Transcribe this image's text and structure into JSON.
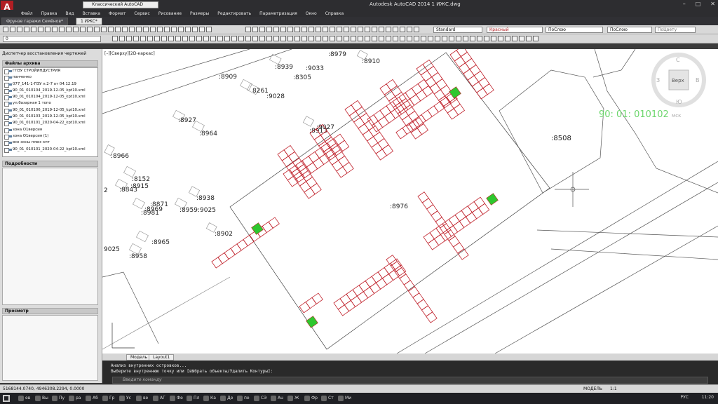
{
  "title": {
    "workspace": "Классический AutoCAD",
    "app": "Autodesk AutoCAD 2014    1 ИЖС.dwg"
  },
  "menu": [
    "Файл",
    "Правка",
    "Вид",
    "Вставка",
    "Формат",
    "Сервис",
    "Рисование",
    "Размеры",
    "Редактировать",
    "Параметризация",
    "Окно",
    "Справка"
  ],
  "tabs": {
    "first": "Фрунзе гаражи Семёнов*",
    "second": "1 ИЖС*"
  },
  "toolbar": {
    "layer_value": "0",
    "text_style": "Standard",
    "color": "Красный",
    "linetype": "ПоСлою",
    "lineweight": "ПоСлою",
    "plotstyle": "ПоЦвету"
  },
  "sidebar": {
    "title": "Диспетчер восстановления чертежей",
    "files_header": "Файлы архива",
    "files": [
      "ГПЗУ СТРОЙИНДУСТРИЯ",
      "панченко",
      "077_141-1-ПЗУ л.2-7 от 04.12.19",
      "90_01_010104_2019-12-05_kpt10.xml",
      "90_01_010104_2019-12-05_kpt10.xml",
      "ул.базарная 1 топо",
      "90_01_010106_2019-12-05_kpt10.xml",
      "90_01_010103_2019-12-05_kpt10.xml",
      "90_01_010101_2020-04-22_kpt10.xml",
      "зона О1версия",
      "зона О1версия (1)",
      "все зоны плюс кпт",
      "90_01_010101_2020-04-22_kpt10.xml"
    ],
    "details_header": "Подробности",
    "preview_header": "Просмотр"
  },
  "canvas": {
    "view_label": "[–][Сверху][2D-каркас]",
    "parcel_labels": [
      ":8979",
      ":8910",
      ":8909",
      ":8939",
      ":9033",
      ":8305",
      ":9028",
      ":8927",
      ":8964",
      ":9027",
      ":8913",
      ":8966",
      ":8152",
      ":8843",
      ":8915",
      ":8938",
      ":8871",
      ":8969",
      ":8981",
      ":8959",
      ":9025",
      ":8902",
      ":8965",
      ":8958",
      ":8976",
      ":8508",
      "9025",
      "2",
      "8261"
    ],
    "cadastral": "90: 01: 010102",
    "cadastral_suffix": "мск",
    "viewcube": {
      "top": "Верх",
      "north": "С",
      "south": "Ю",
      "east": "В",
      "west": "З"
    }
  },
  "layout_tabs": [
    "Модель",
    "Layout1"
  ],
  "command": {
    "line1": "Анализ внутренних островков...",
    "line2": "Выберите внутреннюю точку или [вЫбрать объекты/Удалить Контуры]:",
    "placeholder": "Введите команду"
  },
  "status": {
    "coords": "5168144.0740, 4946308.2294, 0.0000",
    "model": "МОДЕЛЬ",
    "scale": "1:1"
  },
  "taskbar": {
    "tasks": [
      "ев",
      "Вы",
      "Пу",
      "ра",
      "Аб",
      "Гр",
      "Ус",
      "ве",
      "АГ",
      "Фе",
      "Пл",
      "Ка",
      "Де",
      "пе",
      "СЭ",
      "Au",
      "Ж",
      "Фр",
      "Ст",
      "Ми"
    ],
    "lang": "РУС",
    "time": "11:20"
  },
  "colors": {
    "blocks": "#c0202a",
    "green": "#2ec72e",
    "cadastral": "#6cd66c"
  }
}
